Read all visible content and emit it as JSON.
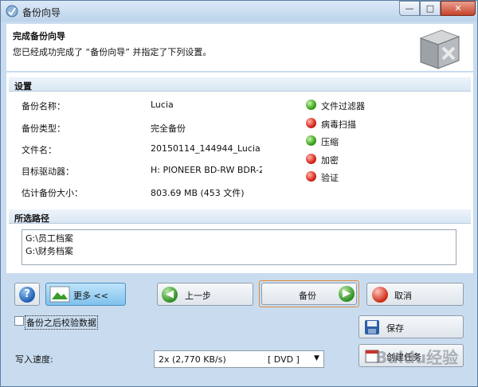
{
  "window": {
    "title": "备份向导",
    "controls": {
      "minimize": "—",
      "maximize": "□",
      "close": "✕"
    }
  },
  "header": {
    "title": "完成备份向导",
    "description": "您已经成功完成了 “备份向导” 并指定了下列设置。"
  },
  "settings": {
    "section_title": "设置",
    "rows": [
      {
        "label": "备份名称：",
        "value": "Lucia"
      },
      {
        "label": "备份类型：",
        "value": "完全备份"
      },
      {
        "label": "文件名：",
        "value": "20150114_144944_Lucia"
      },
      {
        "label": "目标驱动器：",
        "value": "H: PIONEER BD-RW BDR-2"
      },
      {
        "label": "估计备份大小：",
        "value": "803.69 MB (453 文件)"
      }
    ],
    "options": [
      {
        "label": "文件过滤器",
        "status": "enabled",
        "color": "#3aa21a"
      },
      {
        "label": "病毒扫描",
        "status": "disabled",
        "color": "#d8261a"
      },
      {
        "label": "压缩",
        "status": "enabled",
        "color": "#3aa21a"
      },
      {
        "label": "加密",
        "status": "disabled",
        "color": "#d8261a"
      },
      {
        "label": "验证",
        "status": "disabled",
        "color": "#d8261a"
      }
    ]
  },
  "paths": {
    "section_title": "所选路径",
    "items": [
      "G:\\员工档案",
      "G:\\财务档案"
    ]
  },
  "buttons": {
    "help": "?",
    "more": "更多 <<",
    "prev": "上一步",
    "backup": "备份",
    "cancel": "取消",
    "save": "保存",
    "create": "创建任务"
  },
  "verify_checkbox": {
    "label": "备份之后校验数据",
    "checked": false
  },
  "speed": {
    "label": "写入速度:",
    "value": "2x (2,770 KB/s)",
    "media": "[ DVD ]"
  },
  "watermark": "Baidu经验"
}
